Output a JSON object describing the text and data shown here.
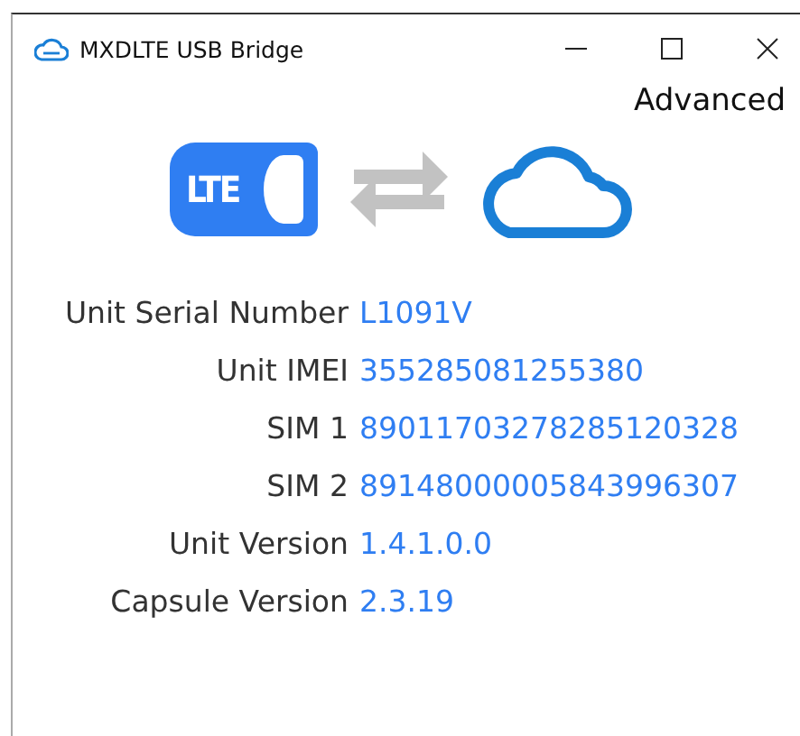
{
  "window": {
    "title": "MXDLTE USB Bridge"
  },
  "advanced_link": "Advanced",
  "status_graphic": {
    "device_label": "LTE"
  },
  "info": [
    {
      "label": "Unit Serial Number",
      "value": "L1091V"
    },
    {
      "label": "Unit IMEI",
      "value": "355285081255380"
    },
    {
      "label": "SIM 1",
      "value": "89011703278285120328"
    },
    {
      "label": "SIM 2",
      "value": "89148000005843996307"
    },
    {
      "label": "Unit Version",
      "value": "1.4.1.0.0"
    },
    {
      "label": "Capsule Version",
      "value": "2.3.19"
    }
  ]
}
